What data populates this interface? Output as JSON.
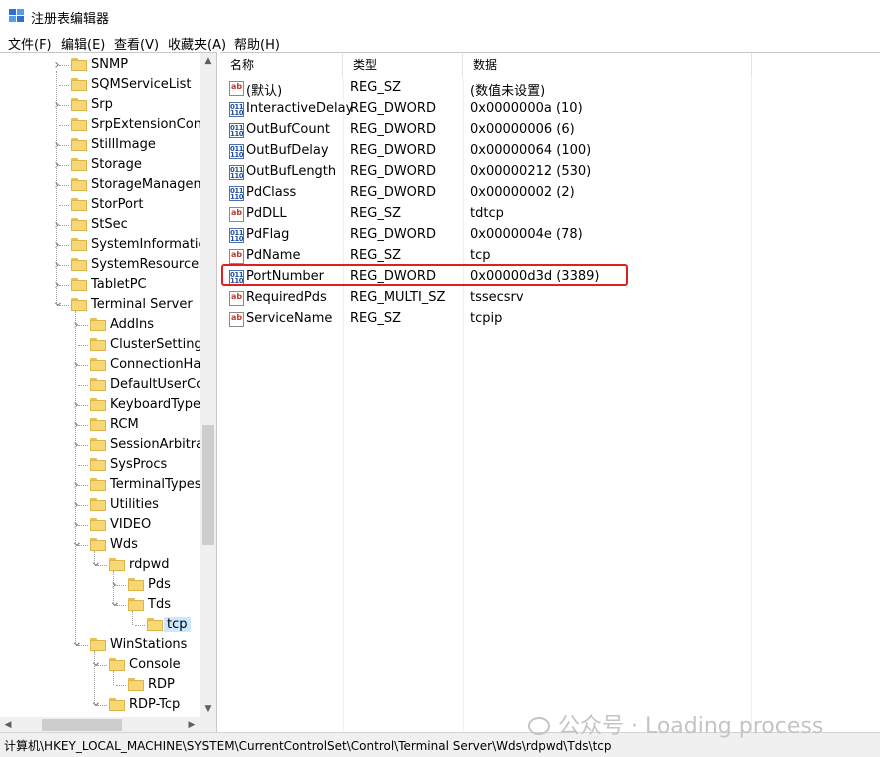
{
  "window": {
    "title": "注册表编辑器"
  },
  "menu": [
    "文件(F)",
    "编辑(E)",
    "查看(V)",
    "收藏夹(A)",
    "帮助(H)"
  ],
  "tree": [
    {
      "label": "SNMP",
      "depth": 0,
      "expander": ">"
    },
    {
      "label": "SQMServiceList",
      "depth": 0,
      "expander": ""
    },
    {
      "label": "Srp",
      "depth": 0,
      "expander": ">"
    },
    {
      "label": "SrpExtensionConfig",
      "depth": 0,
      "expander": ""
    },
    {
      "label": "StillImage",
      "depth": 0,
      "expander": ">"
    },
    {
      "label": "Storage",
      "depth": 0,
      "expander": ">"
    },
    {
      "label": "StorageManagement",
      "depth": 0,
      "expander": ">"
    },
    {
      "label": "StorPort",
      "depth": 0,
      "expander": ""
    },
    {
      "label": "StSec",
      "depth": 0,
      "expander": ">"
    },
    {
      "label": "SystemInformation",
      "depth": 0,
      "expander": ">"
    },
    {
      "label": "SystemResources",
      "depth": 0,
      "expander": ">"
    },
    {
      "label": "TabletPC",
      "depth": 0,
      "expander": ">"
    },
    {
      "label": "Terminal Server",
      "depth": 0,
      "expander": "v"
    },
    {
      "label": "AddIns",
      "depth": 1,
      "expander": ">"
    },
    {
      "label": "ClusterSettings",
      "depth": 1,
      "expander": ""
    },
    {
      "label": "ConnectionHandler",
      "depth": 1,
      "expander": ">"
    },
    {
      "label": "DefaultUserConfiguration",
      "depth": 1,
      "expander": ""
    },
    {
      "label": "KeyboardType Mapping",
      "depth": 1,
      "expander": ">"
    },
    {
      "label": "RCM",
      "depth": 1,
      "expander": ">"
    },
    {
      "label": "SessionArbitrationHelper",
      "depth": 1,
      "expander": ">"
    },
    {
      "label": "SysProcs",
      "depth": 1,
      "expander": ""
    },
    {
      "label": "TerminalTypes",
      "depth": 1,
      "expander": ">"
    },
    {
      "label": "Utilities",
      "depth": 1,
      "expander": ">"
    },
    {
      "label": "VIDEO",
      "depth": 1,
      "expander": ">"
    },
    {
      "label": "Wds",
      "depth": 1,
      "expander": "v"
    },
    {
      "label": "rdpwd",
      "depth": 2,
      "expander": "v"
    },
    {
      "label": "Pds",
      "depth": 3,
      "expander": ">"
    },
    {
      "label": "Tds",
      "depth": 3,
      "expander": "v"
    },
    {
      "label": "tcp",
      "depth": 4,
      "expander": "",
      "selected": true
    },
    {
      "label": "WinStations",
      "depth": 1,
      "expander": "v"
    },
    {
      "label": "Console",
      "depth": 2,
      "expander": "v"
    },
    {
      "label": "RDP",
      "depth": 3,
      "expander": ""
    },
    {
      "label": "RDP-Tcp",
      "depth": 2,
      "expander": "v"
    }
  ],
  "columns": {
    "name": "名称",
    "type": "类型",
    "data": "数据"
  },
  "values": [
    {
      "icon": "string-value-icon",
      "name": "(默认)",
      "type": "REG_SZ",
      "data": "(数值未设置)"
    },
    {
      "icon": "dword-value-icon",
      "name": "InteractiveDelay",
      "type": "REG_DWORD",
      "data": "0x0000000a (10)"
    },
    {
      "icon": "dword-value-icon",
      "name": "OutBufCount",
      "type": "REG_DWORD",
      "data": "0x00000006 (6)"
    },
    {
      "icon": "dword-value-icon",
      "name": "OutBufDelay",
      "type": "REG_DWORD",
      "data": "0x00000064 (100)"
    },
    {
      "icon": "dword-value-icon",
      "name": "OutBufLength",
      "type": "REG_DWORD",
      "data": "0x00000212 (530)"
    },
    {
      "icon": "dword-value-icon",
      "name": "PdClass",
      "type": "REG_DWORD",
      "data": "0x00000002 (2)"
    },
    {
      "icon": "string-value-icon",
      "name": "PdDLL",
      "type": "REG_SZ",
      "data": "tdtcp"
    },
    {
      "icon": "dword-value-icon",
      "name": "PdFlag",
      "type": "REG_DWORD",
      "data": "0x0000004e (78)"
    },
    {
      "icon": "string-value-icon",
      "name": "PdName",
      "type": "REG_SZ",
      "data": "tcp"
    },
    {
      "icon": "dword-value-icon",
      "name": "PortNumber",
      "type": "REG_DWORD",
      "data": "0x00000d3d (3389)",
      "highlighted": true
    },
    {
      "icon": "string-value-icon",
      "name": "RequiredPds",
      "type": "REG_MULTI_SZ",
      "data": "tssecsrv"
    },
    {
      "icon": "string-value-icon",
      "name": "ServiceName",
      "type": "REG_SZ",
      "data": "tcpip"
    }
  ],
  "status": {
    "path": "计算机\\HKEY_LOCAL_MACHINE\\SYSTEM\\CurrentControlSet\\Control\\Terminal Server\\Wds\\rdpwd\\Tds\\tcp"
  },
  "watermark": {
    "text": "公众号 · Loading process"
  },
  "colors": {
    "highlight_border": "#e02020",
    "selected_bg": "#cce8ff",
    "folder": "#f6d774"
  },
  "icons": {
    "app": "regedit-app-icon",
    "folder": "folder-icon"
  }
}
